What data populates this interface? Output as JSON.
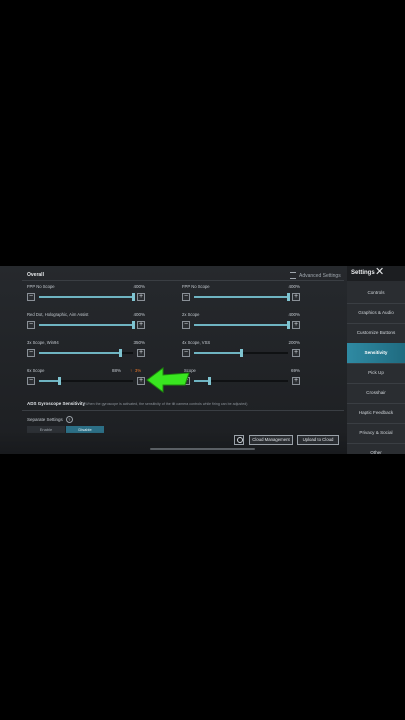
{
  "header": {
    "overall": "Overall",
    "advanced_settings": "Advanced Settings"
  },
  "rows": [
    {
      "label": "FPP No Scope",
      "value": "400%",
      "fill": 1.0
    },
    {
      "label": "FPP No Scope",
      "value": "400%",
      "fill": 1.0
    },
    {
      "label": "Red Dot, Holographic, Aim Assist",
      "value": "400%",
      "fill": 1.0
    },
    {
      "label": "2x Scope",
      "value": "400%",
      "fill": 1.0
    },
    {
      "label": "3x Scope, Win94",
      "value": "350%",
      "fill": 0.87
    },
    {
      "label": "4x Scope, VSS",
      "value": "200%",
      "fill": 0.5
    },
    {
      "label": "6x Scope",
      "value": "88%",
      "fill": 0.22
    },
    {
      "label": "Scope",
      "value": "69%",
      "fill": 0.17
    }
  ],
  "warning": "3%",
  "ads": {
    "title": "ADS Gyroscope Sensitivity",
    "note": "(When the gyroscope is activated, the sensitivity of the tilt camera controls while firing can be adjusted)"
  },
  "separate": {
    "label": "Separate Settings",
    "options": [
      "Enable",
      "Disable"
    ]
  },
  "bottom": {
    "cloud_management": "Cloud Management",
    "upload_to_cloud": "Upload to Cloud"
  },
  "sidebar": {
    "title": "Settings",
    "items": [
      "Controls",
      "Graphics & Audio",
      "Customize Buttons",
      "Sensitivity",
      "Pick Up",
      "Crosshair",
      "Haptic Feedback",
      "Privacy & Social",
      "Other"
    ]
  },
  "colors": {
    "accent": "#2f8aa3",
    "slider": "#6fb4c2",
    "warning": "#f07a2a",
    "arrow": "#39e620"
  }
}
